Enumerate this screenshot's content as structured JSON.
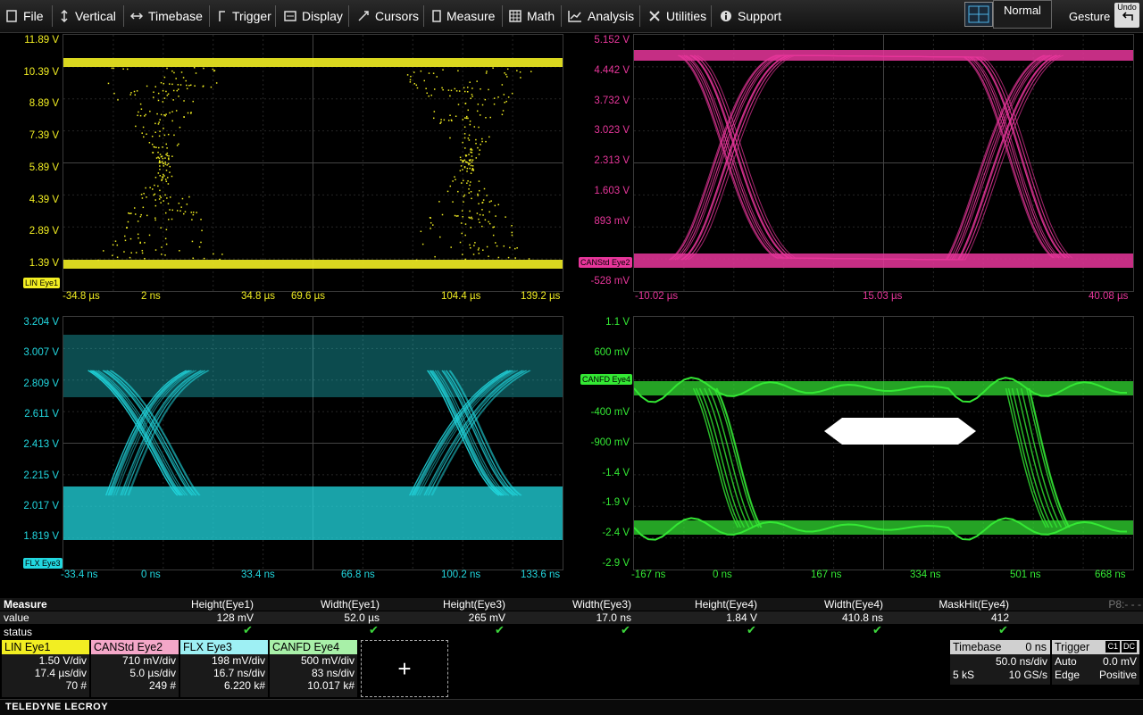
{
  "menubar": {
    "items": [
      "File",
      "Vertical",
      "Timebase",
      "Trigger",
      "Display",
      "Cursors",
      "Measure",
      "Math",
      "Analysis",
      "Utilities",
      "Support"
    ],
    "icons": [
      "file-icon",
      "vertical-icon",
      "timebase-icon",
      "trigger-icon",
      "display-icon",
      "cursors-icon",
      "measure-icon",
      "math-icon",
      "analysis-icon",
      "utilities-icon",
      "support-icon"
    ],
    "mode": "Normal",
    "gesture": "Gesture",
    "undo": "Undo"
  },
  "grids": [
    {
      "id": "eye1",
      "color": "#f2ee22",
      "ylabels": [
        "11.89 V",
        "10.39 V",
        "8.89 V",
        "7.39 V",
        "5.89 V",
        "4.39 V",
        "2.89 V",
        "1.39 V"
      ],
      "xlabels": [
        "-34.8 µs",
        "2 ns",
        "34.8 µs",
        "69.6 µs",
        "104.4 µs",
        "139.2 µs"
      ],
      "tag": "LIN Eye1"
    },
    {
      "id": "eye2",
      "color": "#e8369b",
      "ylabels": [
        "5.152 V",
        "4.442 V",
        "3.732 V",
        "3.023 V",
        "2.313 V",
        "1.603 V",
        "893 mV",
        "",
        "-528 mV"
      ],
      "xlabels": [
        "-10.02 µs",
        "15.03 µs",
        "40.08 µs"
      ],
      "tag": "CANStd Eye2"
    },
    {
      "id": "eye3",
      "color": "#22d8e0",
      "ylabels": [
        "3.204 V",
        "3.007 V",
        "2.809 V",
        "2.611 V",
        "2.413 V",
        "2.215 V",
        "2.017 V",
        "1.819 V"
      ],
      "xlabels": [
        "-33.4 ns",
        "0 ns",
        "33.4 ns",
        "66.8 ns",
        "100.2 ns",
        "133.6 ns"
      ],
      "tag": "FLX Eye3"
    },
    {
      "id": "eye4",
      "color": "#34e834",
      "ylabels": [
        "1.1 V",
        "600 mV",
        "",
        "-400 mV",
        "-900 mV",
        "-1.4 V",
        "-1.9 V",
        "-2.4 V",
        "-2.9 V"
      ],
      "xlabels": [
        "-167 ns",
        "0 ns",
        "167 ns",
        "334 ns",
        "501 ns",
        "668 ns"
      ],
      "tag": "CANFD Eye4"
    }
  ],
  "measure": {
    "title": "Measure",
    "row_value": "value",
    "row_status": "status",
    "page": "P8:- - -",
    "params": [
      {
        "name": "Height(Eye1)",
        "value": "128 mV"
      },
      {
        "name": "Width(Eye1)",
        "value": "52.0 µs"
      },
      {
        "name": "Height(Eye3)",
        "value": "265 mV"
      },
      {
        "name": "Width(Eye3)",
        "value": "17.0 ns"
      },
      {
        "name": "Height(Eye4)",
        "value": "1.84 V"
      },
      {
        "name": "Width(Eye4)",
        "value": "410.8 ns"
      },
      {
        "name": "MaskHit(Eye4)",
        "value": "412"
      }
    ],
    "check": "✔"
  },
  "descriptors": [
    {
      "title": "LIN Eye1",
      "color": "#f2ee22",
      "lines": [
        "1.50 V/div",
        "17.4 µs/div",
        "70 #"
      ]
    },
    {
      "title": "CANStd Eye2",
      "color": "#f4a7c8",
      "lines": [
        "710 mV/div",
        "5.0 µs/div",
        "249 #"
      ]
    },
    {
      "title": "FLX Eye3",
      "color": "#9ef0f4",
      "lines": [
        "198 mV/div",
        "16.7 ns/div",
        "6.220 k#"
      ]
    },
    {
      "title": "CANFD Eye4",
      "color": "#a8f0a8",
      "lines": [
        "500 mV/div",
        "83 ns/div",
        "10.017 k#"
      ]
    }
  ],
  "add_trace": "+",
  "timebase": {
    "title": "Timebase",
    "delay": "0 ns",
    "per_div": "50.0 ns/div",
    "samples": "5 kS",
    "rate": "10 GS/s"
  },
  "trigger": {
    "title": "Trigger",
    "badge1": "C1",
    "badge2": "DC",
    "mode": "Auto",
    "level": "0.0 mV",
    "type": "Edge",
    "slope": "Positive"
  },
  "brand": "TELEDYNE LECROY"
}
